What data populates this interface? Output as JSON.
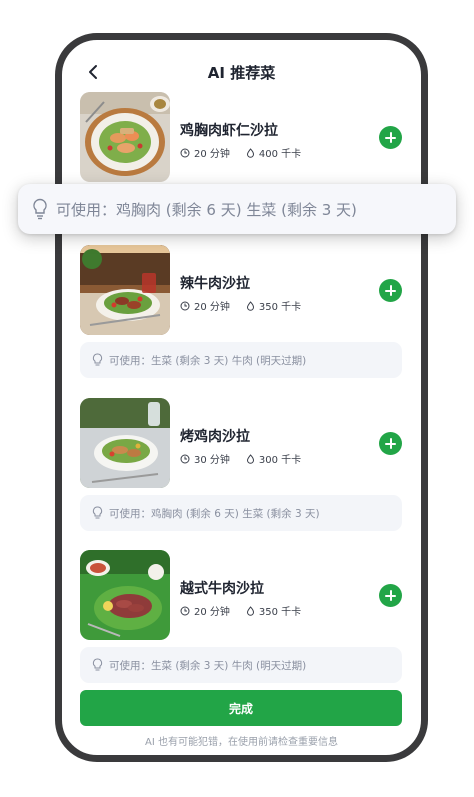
{
  "header": {
    "title": "AI 推荐菜",
    "back_icon": "chevron-left-icon"
  },
  "dishes": [
    {
      "name": "鸡胸肉虾仁沙拉",
      "time": "20 分钟",
      "calories": "400 千卡",
      "usable": "可使用：鸡胸肉 (剩余 6 天)  生菜 (剩余 3 天)"
    },
    {
      "name": "辣牛肉沙拉",
      "time": "20 分钟",
      "calories": "350 千卡",
      "usable": "可使用：生菜 (剩余 3 天)  牛肉 (明天过期)"
    },
    {
      "name": "烤鸡肉沙拉",
      "time": "30 分钟",
      "calories": "300 千卡",
      "usable": "可使用：鸡胸肉 (剩余 6 天)  生菜 (剩余 3 天)"
    },
    {
      "name": "越式牛肉沙拉",
      "time": "20 分钟",
      "calories": "350 千卡",
      "usable": "可使用：生菜 (剩余 3 天)  牛肉 (明天过期)"
    }
  ],
  "callout": {
    "text": "可使用：鸡胸肉 (剩余 6 天)  生菜 (剩余 3 天)"
  },
  "footer": {
    "done_label": "完成",
    "disclaimer": "AI 也有可能犯错，在使用前请检查重要信息"
  },
  "colors": {
    "accent": "#22a547",
    "frame": "#3a3a3c",
    "hint_bg": "#f3f5f9",
    "hint_text": "#8a90a0"
  }
}
